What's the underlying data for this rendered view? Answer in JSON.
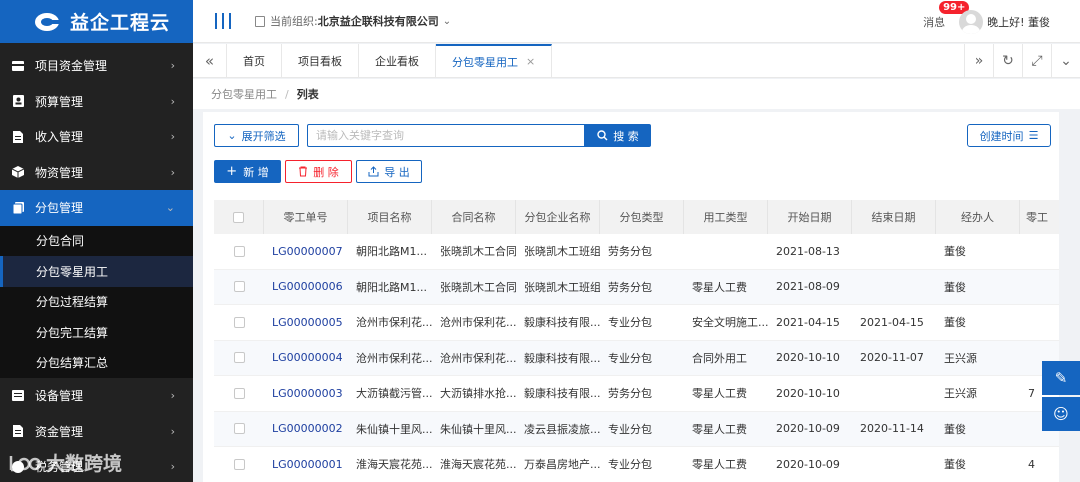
{
  "brand": {
    "name": "益企工程云"
  },
  "topbar": {
    "org_label": "当前组织:",
    "org_name": "北京益企联科技有限公司",
    "message_label": "消息",
    "message_badge": "99+",
    "greeting": "晚上好! 董俊"
  },
  "sidebar": {
    "items": [
      {
        "label": "项目资金管理",
        "icon": "card-icon"
      },
      {
        "label": "预算管理",
        "icon": "contact-icon"
      },
      {
        "label": "收入管理",
        "icon": "file-icon"
      },
      {
        "label": "物资管理",
        "icon": "box-icon"
      },
      {
        "label": "分包管理",
        "icon": "doc-icon"
      }
    ],
    "sub_items": [
      "分包合同",
      "分包零星用工",
      "分包过程结算",
      "分包完工结算",
      "分包结算汇总"
    ],
    "bottom_items": [
      {
        "label": "设备管理",
        "icon": "list-icon"
      },
      {
        "label": "资金管理",
        "icon": "file-icon"
      },
      {
        "label": "税务管理",
        "icon": "tax-icon"
      }
    ]
  },
  "tabs": {
    "items": [
      "首页",
      "项目看板",
      "企业看板",
      "分包零星用工"
    ]
  },
  "breadcrumb": {
    "parent": "分包零星用工",
    "current": "列表"
  },
  "toolbar": {
    "filter_label": "展开筛选",
    "search_placeholder": "请输入关键字查询",
    "search_label": "搜 索",
    "sort_label": "创建时间",
    "add_label": "新 增",
    "delete_label": "删 除",
    "export_label": "导 出"
  },
  "table": {
    "columns": [
      "零工单号",
      "项目名称",
      "合同名称",
      "分包企业名称",
      "分包类型",
      "用工类型",
      "开始日期",
      "结束日期",
      "经办人",
      "零工"
    ],
    "rows": [
      [
        "LG00000007",
        "朝阳北路M1...",
        "张晓凯木工合同",
        "张晓凯木工班组",
        "劳务分包",
        "",
        "2021-08-13",
        "",
        "董俊",
        ""
      ],
      [
        "LG00000006",
        "朝阳北路M1...",
        "张晓凯木工合同",
        "张晓凯木工班组",
        "劳务分包",
        "零星人工费",
        "2021-08-09",
        "",
        "董俊",
        ""
      ],
      [
        "LG00000005",
        "沧州市保利花...",
        "沧州市保利花...",
        "毅康科技有限...",
        "专业分包",
        "安全文明施工...",
        "2021-04-15",
        "2021-04-15",
        "董俊",
        ""
      ],
      [
        "LG00000004",
        "沧州市保利花...",
        "沧州市保利花...",
        "毅康科技有限...",
        "专业分包",
        "合同外用工",
        "2020-10-10",
        "2020-11-07",
        "王兴源",
        ""
      ],
      [
        "LG00000003",
        "大沥镇截污管...",
        "大沥镇排水抢...",
        "毅康科技有限...",
        "劳务分包",
        "零星人工费",
        "2020-10-10",
        "",
        "王兴源",
        "7"
      ],
      [
        "LG00000002",
        "朱仙镇十里风...",
        "朱仙镇十里风...",
        "凌云县振凌旅...",
        "专业分包",
        "零星人工费",
        "2020-10-09",
        "2020-11-14",
        "董俊",
        ""
      ],
      [
        "LG00000001",
        "淮海天宸花苑...",
        "淮海天宸花苑...",
        "万泰昌房地产...",
        "专业分包",
        "零星人工费",
        "2020-10-09",
        "",
        "董俊",
        "4"
      ]
    ]
  },
  "watermark": {
    "text": "大数跨境"
  },
  "colors": {
    "primary": "#1565c0",
    "danger": "#f5222d",
    "sidebar": "#222222"
  }
}
